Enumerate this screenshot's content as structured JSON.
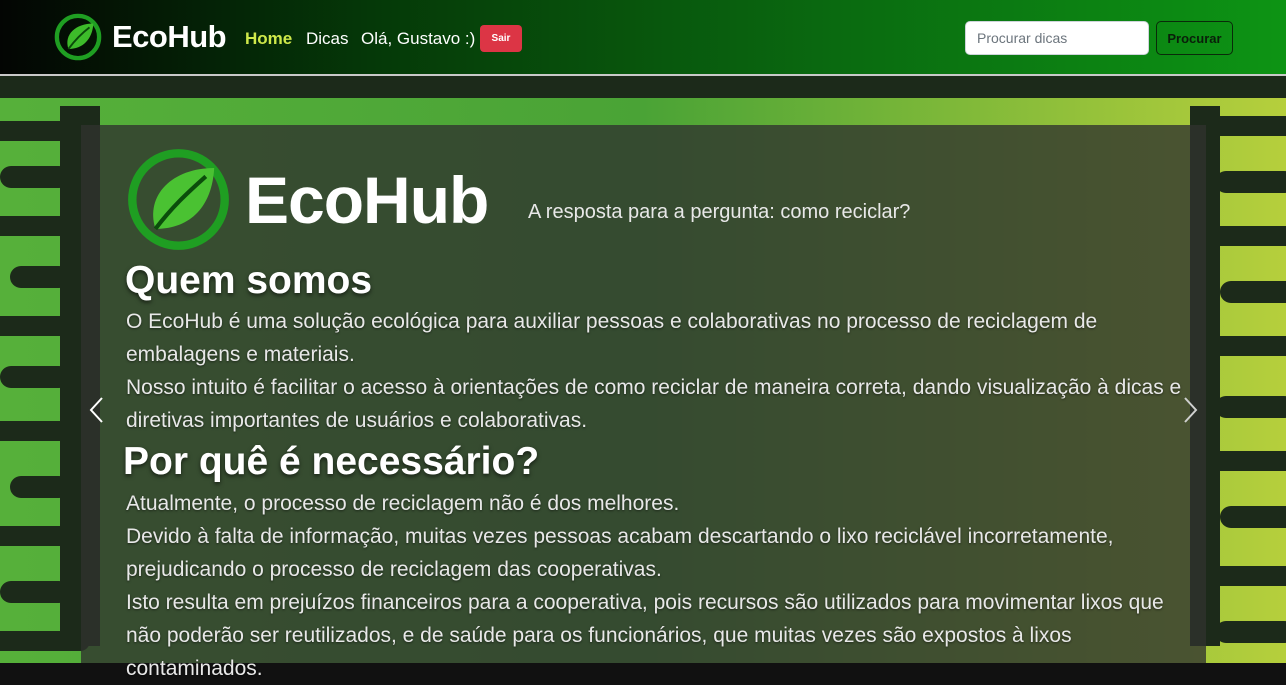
{
  "navbar": {
    "brand": "EcoHub",
    "links": [
      "Home",
      "Dicas"
    ],
    "greeting": "Olá, Gustavo :)",
    "logout_label": "Sair",
    "search_placeholder": "Procurar dicas",
    "search_button": "Procurar"
  },
  "hero": {
    "title": "EcoHub",
    "tagline": "A resposta para a pergunta: como reciclar?",
    "sections": [
      {
        "heading": "Quem somos",
        "lines": [
          "O EcoHub é uma solução ecológica para auxiliar pessoas e colaborativas no processo de reciclagem de embalagens e materiais.",
          "Nosso intuito é facilitar o acesso à orientações de como reciclar de maneira correta, dando visualização à dicas e diretivas importantes de usuários e colaborativas."
        ]
      },
      {
        "heading": "Por quê é necessário?",
        "lines": [
          "Atualmente, o processo de reciclagem não é dos melhores.",
          "Devido à falta de informação, muitas vezes pessoas acabam descartando o lixo reciclável incorretamente, prejudicando o processo de reciclagem das cooperativas.",
          "Isto resulta em prejuízos financeiros para a cooperativa, pois recursos são utilizados para movimentar lixos que não poderão ser reutilizados, e de saúde para os funcionários, que muitas vezes são expostos à lixos contaminados."
        ]
      }
    ]
  },
  "colors": {
    "accent": "#cfe84a",
    "danger": "#dc3545",
    "nav_dark": "#030503",
    "nav_green": "#0d9414"
  },
  "icons": {
    "brand": "leaf-logo-icon",
    "prev": "chevron-left-icon",
    "next": "chevron-right-icon"
  }
}
